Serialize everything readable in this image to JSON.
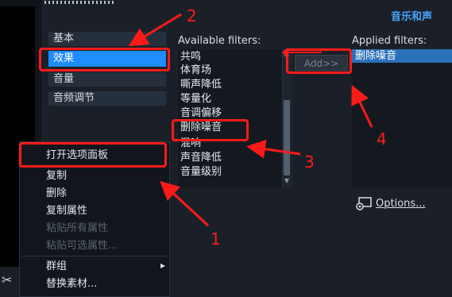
{
  "panel": {
    "title": "音乐和声"
  },
  "categories": [
    {
      "label": "基本"
    },
    {
      "label": "效果"
    },
    {
      "label": "音量"
    },
    {
      "label": "音频调节"
    }
  ],
  "available": {
    "label": "Available filters:",
    "items": [
      "共鸣",
      "体育场",
      "嘶声降低",
      "等量化",
      "音调偏移",
      "删除噪音",
      "混响",
      "声音降低",
      "音量级别"
    ]
  },
  "add_button": {
    "label": "Add>>"
  },
  "applied": {
    "label": "Applied filters:",
    "items": [
      "删除噪音"
    ]
  },
  "options": {
    "label": "Options..."
  },
  "context_menu": {
    "items": [
      {
        "label": "打开选项面板",
        "disabled": false
      },
      {
        "label": "复制",
        "disabled": false
      },
      {
        "label": "删除",
        "disabled": false
      },
      {
        "label": "复制属性",
        "disabled": false
      },
      {
        "label": "粘贴所有属性",
        "disabled": true
      },
      {
        "label": "粘贴可选属性...",
        "disabled": true
      },
      {
        "label": "群组",
        "disabled": false
      },
      {
        "label": "替换素材...",
        "disabled": false
      }
    ]
  },
  "annotations": {
    "n1": "1",
    "n2": "2",
    "n3": "3",
    "n4": "4",
    "color": "#ff1a1a"
  },
  "colors": {
    "accent": "#1f8dff",
    "title": "#46a6ff",
    "selected": "#2a70b8"
  },
  "icons": {
    "scissors": "scissors-icon",
    "options": "options-icon"
  }
}
